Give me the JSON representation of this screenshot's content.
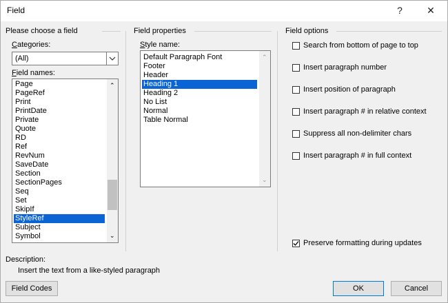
{
  "window": {
    "title": "Field",
    "help_label": "?",
    "close_label": "✕"
  },
  "left": {
    "section_title": "Please choose a field",
    "categories_label": "Categories:",
    "categories_value": "(All)",
    "field_names_label": "Field names:",
    "field_names": [
      "Page",
      "PageRef",
      "Print",
      "PrintDate",
      "Private",
      "Quote",
      "RD",
      "Ref",
      "RevNum",
      "SaveDate",
      "Section",
      "SectionPages",
      "Seq",
      "Set",
      "SkipIf",
      "StyleRef",
      "Subject",
      "Symbol"
    ],
    "selected_field": "StyleRef"
  },
  "middle": {
    "section_title": "Field properties",
    "style_name_label": "Style name:",
    "styles": [
      "Default Paragraph Font",
      "Footer",
      "Header",
      "Heading 1",
      "Heading 2",
      "No List",
      "Normal",
      "Table Normal"
    ],
    "selected_style": "Heading 1"
  },
  "right": {
    "section_title": "Field options",
    "options": [
      {
        "label": "Search from bottom of page to top",
        "checked": false
      },
      {
        "label": "Insert paragraph number",
        "checked": false
      },
      {
        "label": "Insert position of paragraph",
        "checked": false
      },
      {
        "label": "Insert paragraph # in relative context",
        "checked": false
      },
      {
        "label": "Suppress all non-delimiter chars",
        "checked": false
      },
      {
        "label": "Insert paragraph # in full context",
        "checked": false
      }
    ],
    "preserve_label": "Preserve formatting during updates",
    "preserve_checked": true
  },
  "description": {
    "label": "Description:",
    "text": "Insert the text from a like-styled paragraph"
  },
  "buttons": {
    "field_codes": "Field Codes",
    "ok": "OK",
    "cancel": "Cancel"
  }
}
